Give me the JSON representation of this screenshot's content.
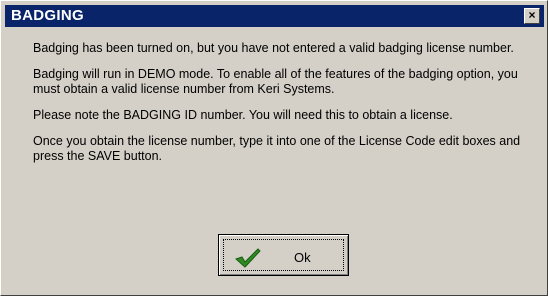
{
  "dialog": {
    "title": "BADGING",
    "close_label": "×",
    "paragraphs": [
      "Badging has been turned on, but you have not entered a valid badging license number.",
      "Badging will run in DEMO mode.  To enable all of the features of the badging option, you must obtain a valid license number from Keri Systems.",
      "Please note the BADGING ID number.  You will need this to obtain a license.",
      "Once you obtain the license number, type it into one of the License Code edit boxes and press the SAVE button."
    ],
    "ok_button": {
      "label": "Ok",
      "icon": "green-check-icon"
    }
  },
  "colors": {
    "titlebar": "#0a246a",
    "face": "#d4d0c8",
    "check": "#2e8b22"
  }
}
